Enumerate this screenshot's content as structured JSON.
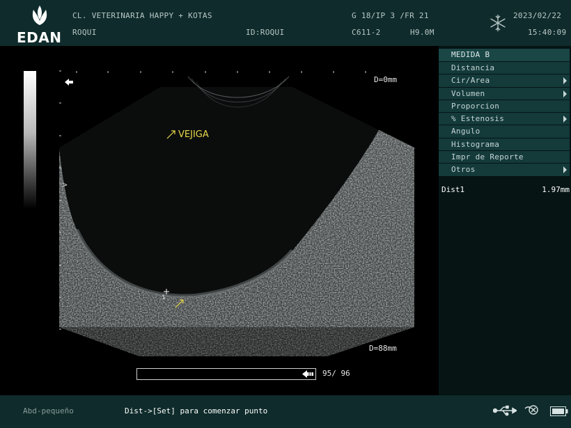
{
  "header": {
    "brand": "EDAN",
    "clinic": "CL. VETERINARIA HAPPY + KOTAS",
    "patient": "ROQUI",
    "patient_id": "ID:ROQUI",
    "gain_info": "G 18/IP 3 /FR 21",
    "probe": "C611-2",
    "freq": "H9.0M",
    "date": "2023/02/22",
    "time": "15:40:09",
    "freeze_icon": "snowflake-icon"
  },
  "scan": {
    "depth_top": "D=0mm",
    "depth_bottom": "D=88mm",
    "annotation": "VEJIGA",
    "focus_marker": ">",
    "caliper_label": "1",
    "cine_counter": "95/ 96"
  },
  "menu": {
    "title": "MEDIDA B",
    "items": [
      {
        "label": "Distancia"
      },
      {
        "label": "Cir/Area"
      },
      {
        "label": "Volumen"
      },
      {
        "label": "Proporcion"
      },
      {
        "label": "% Estenosis"
      },
      {
        "label": "Angulo"
      },
      {
        "label": "Histograma"
      },
      {
        "label": "Impr de Reporte"
      },
      {
        "label": "Otros"
      }
    ]
  },
  "results": [
    {
      "name": "Dist1",
      "value": "1.97mm"
    }
  ],
  "footer": {
    "preset": "Abd-pequeño",
    "prompt": "Dist->[Set] para comenzar punto",
    "icons": [
      "usb-icon",
      "printer-icon",
      "battery-icon"
    ]
  },
  "colors": {
    "header_bg": "#0f2b2b",
    "menu_bg": "#143a3a",
    "annotation": "#e8d84a"
  }
}
